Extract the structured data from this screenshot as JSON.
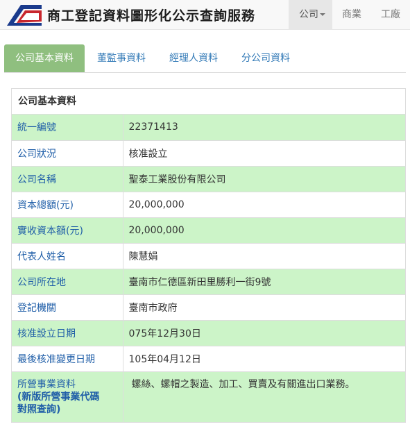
{
  "header": {
    "title": "商工登記資料圖形化公示查詢服務",
    "nav": [
      {
        "label": "公司",
        "dropdown": true,
        "active": true
      },
      {
        "label": "商業",
        "dropdown": false,
        "active": false
      },
      {
        "label": "工廠",
        "dropdown": false,
        "active": false
      }
    ]
  },
  "tabs": [
    {
      "label": "公司基本資料",
      "active": true
    },
    {
      "label": "董監事資料",
      "active": false
    },
    {
      "label": "經理人資料",
      "active": false
    },
    {
      "label": "分公司資料",
      "active": false
    }
  ],
  "panel": {
    "heading": "公司基本資料",
    "rows": [
      {
        "key": "統一編號",
        "value": "22371413"
      },
      {
        "key": "公司狀況",
        "value": "核准設立"
      },
      {
        "key": "公司名稱",
        "value": "聖泰工業股份有限公司"
      },
      {
        "key": "資本總額(元)",
        "value": "20,000,000"
      },
      {
        "key": "實收資本額(元)",
        "value": "20,000,000"
      },
      {
        "key": "代表人姓名",
        "value": "陳慧娟"
      },
      {
        "key": "公司所在地",
        "value": "臺南市仁德區新田里勝利一街9號"
      },
      {
        "key": "登記機關",
        "value": "臺南市政府"
      },
      {
        "key": "核准設立日期",
        "value": "075年12月30日"
      },
      {
        "key": "最後核准變更日期",
        "value": "105年04月12日"
      }
    ],
    "business": {
      "key_line1": "所營事業資料",
      "key_line2": "(新版所營事業代碼",
      "key_line3": "對照查詢)",
      "value": "螺絲、螺帽之製造、加工、買賣及有關進出口業務。"
    }
  },
  "colors": {
    "accent_tab": "#8fbf7f",
    "row_green": "#ccf4c8",
    "link": "#1f5ea8"
  }
}
